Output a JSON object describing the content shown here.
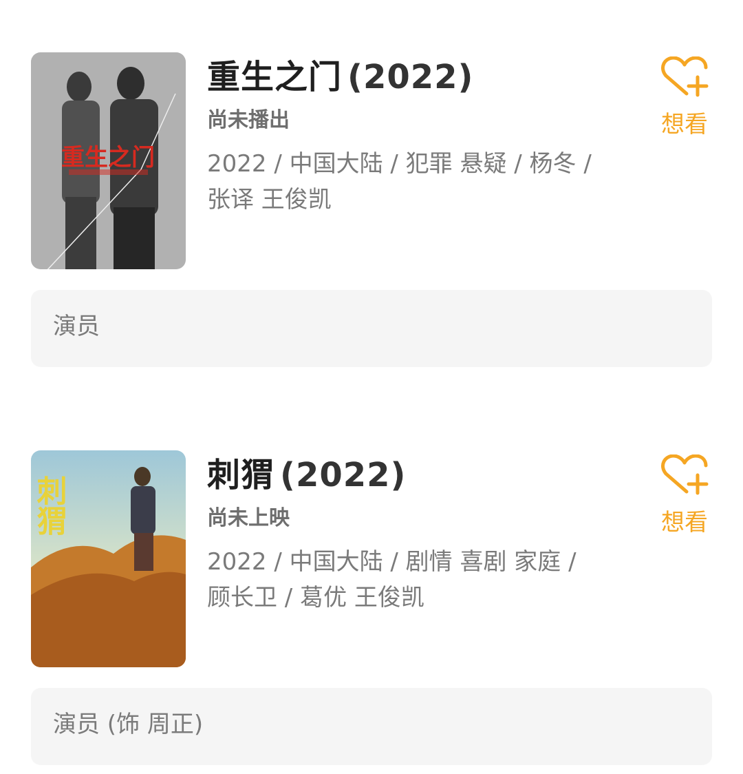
{
  "movies": [
    {
      "title": "重生之门",
      "year": "(2022)",
      "status": "尚未播出",
      "meta": "2022 / 中国大陆 / 犯罪 悬疑 / 杨冬 / 张译 王俊凯",
      "wish_label": "想看",
      "role": "演员",
      "poster_icon": "movie-poster-image",
      "poster_text": "重生之门",
      "accent": "#f5a623"
    },
    {
      "title": "刺猬",
      "year": "(2022)",
      "status": "尚未上映",
      "meta": "2022 / 中国大陆 / 剧情 喜剧 家庭 / 顾长卫 / 葛优 王俊凯",
      "wish_label": "想看",
      "role": "演员 (饰 周正)",
      "poster_icon": "movie-poster-image",
      "poster_text": "刺猬",
      "accent": "#f5a623"
    }
  ]
}
